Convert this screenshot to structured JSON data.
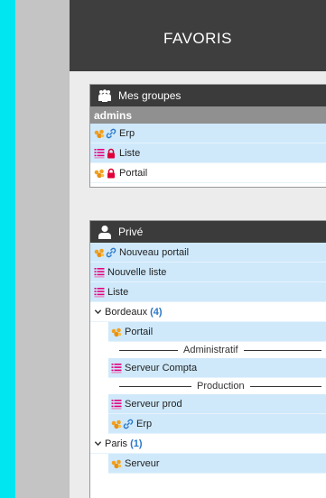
{
  "header": {
    "title": "FAVORIS"
  },
  "groups_card": {
    "title": "Mes groupes",
    "group_name": "admins",
    "items": [
      {
        "label": "Erp",
        "icons": [
          "portal-icon",
          "link-icon"
        ]
      },
      {
        "label": "Liste",
        "icons": [
          "list-icon",
          "lock-icon"
        ]
      },
      {
        "label": "Portail",
        "icons": [
          "portal-icon",
          "lock-icon"
        ]
      }
    ]
  },
  "private_card": {
    "title": "Privé",
    "items": [
      {
        "label": "Nouveau portail"
      },
      {
        "label": "Nouvelle liste"
      },
      {
        "label": "Liste"
      }
    ],
    "folders": [
      {
        "name": "Bordeaux",
        "count": "(4)",
        "entries": [
          {
            "label": "Portail"
          },
          {
            "separator": "Administratif"
          },
          {
            "label": "Serveur Compta"
          },
          {
            "separator": "Production"
          },
          {
            "label": "Serveur prod"
          },
          {
            "label": "Erp"
          }
        ]
      },
      {
        "name": "Paris",
        "count": "(1)",
        "entries": [
          {
            "label": "Serveur"
          }
        ]
      }
    ]
  },
  "colors": {
    "header_bg": "#3e3e3e",
    "row_bg": "#cfe9fb",
    "accent": "#2a78c8",
    "lock": "#e0003a",
    "list": "#e4007c",
    "portal": "#f0a020"
  }
}
